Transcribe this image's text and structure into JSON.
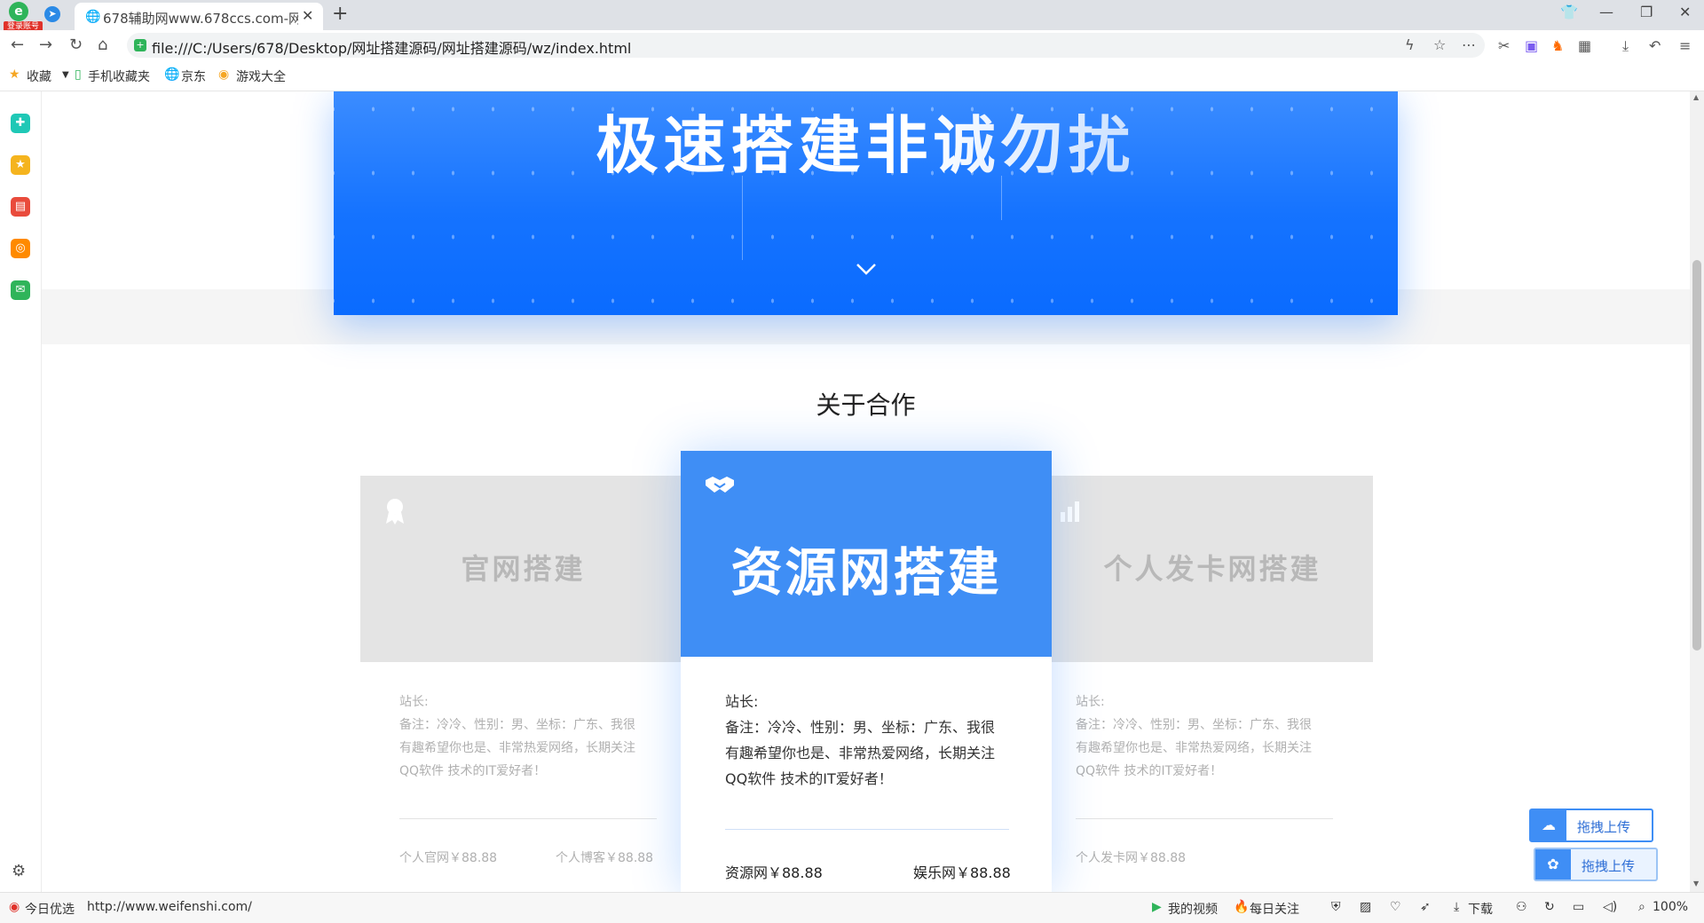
{
  "browser": {
    "logo_badge": "登录账号",
    "tab_title": "678辅助网www.678ccs.com-网",
    "url": "file:///C:/Users/678/Desktop/网址搭建源码/网址搭建源码/wz/index.html",
    "bookmarks": [
      "收藏",
      "手机收藏夹",
      "京东",
      "游戏大全"
    ]
  },
  "hero": {
    "title": "极速搭建非诚勿扰"
  },
  "section": {
    "title": "关于合作"
  },
  "cards": {
    "left": {
      "name": "官网搭建",
      "owner_label": "站长:",
      "desc_lines": [
        "备注：冷冷、性别：男、坐标：广东、我很",
        "有趣希望你也是、非常热爱网络，长期关注",
        "QQ软件 技术的IT爱好者！"
      ],
      "price1": "个人官网￥88.88",
      "price2": "个人博客￥88.88"
    },
    "middle": {
      "name": "资源网搭建",
      "owner_label": "站长:",
      "desc_lines": [
        "备注：冷冷、性别：男、坐标：广东、我很",
        "有趣希望你也是、非常热爱网络，长期关注",
        "QQ软件 技术的IT爱好者！"
      ],
      "price1": "资源网￥88.88",
      "price2": "娱乐网￥88.88"
    },
    "right": {
      "name": "个人发卡网搭建",
      "owner_label": "站长:",
      "desc_lines": [
        "备注：冷冷、性别：男、坐标：广东、我很",
        "有趣希望你也是、非常热爱网络，长期关注",
        "QQ软件 技术的IT爱好者！"
      ],
      "price1": "个人发卡网￥88.88"
    }
  },
  "upload": {
    "label": "拖拽上传"
  },
  "status": {
    "today": "今日优选",
    "link": "http://www.weifenshi.com/",
    "my_video": "我的视频",
    "daily": "每日关注",
    "download": "下载",
    "zoom": "100%"
  },
  "colors": {
    "hero_blue": "#1573ff",
    "card_blue": "#3f8ef5",
    "upload_blue": "#3f8ef5"
  }
}
